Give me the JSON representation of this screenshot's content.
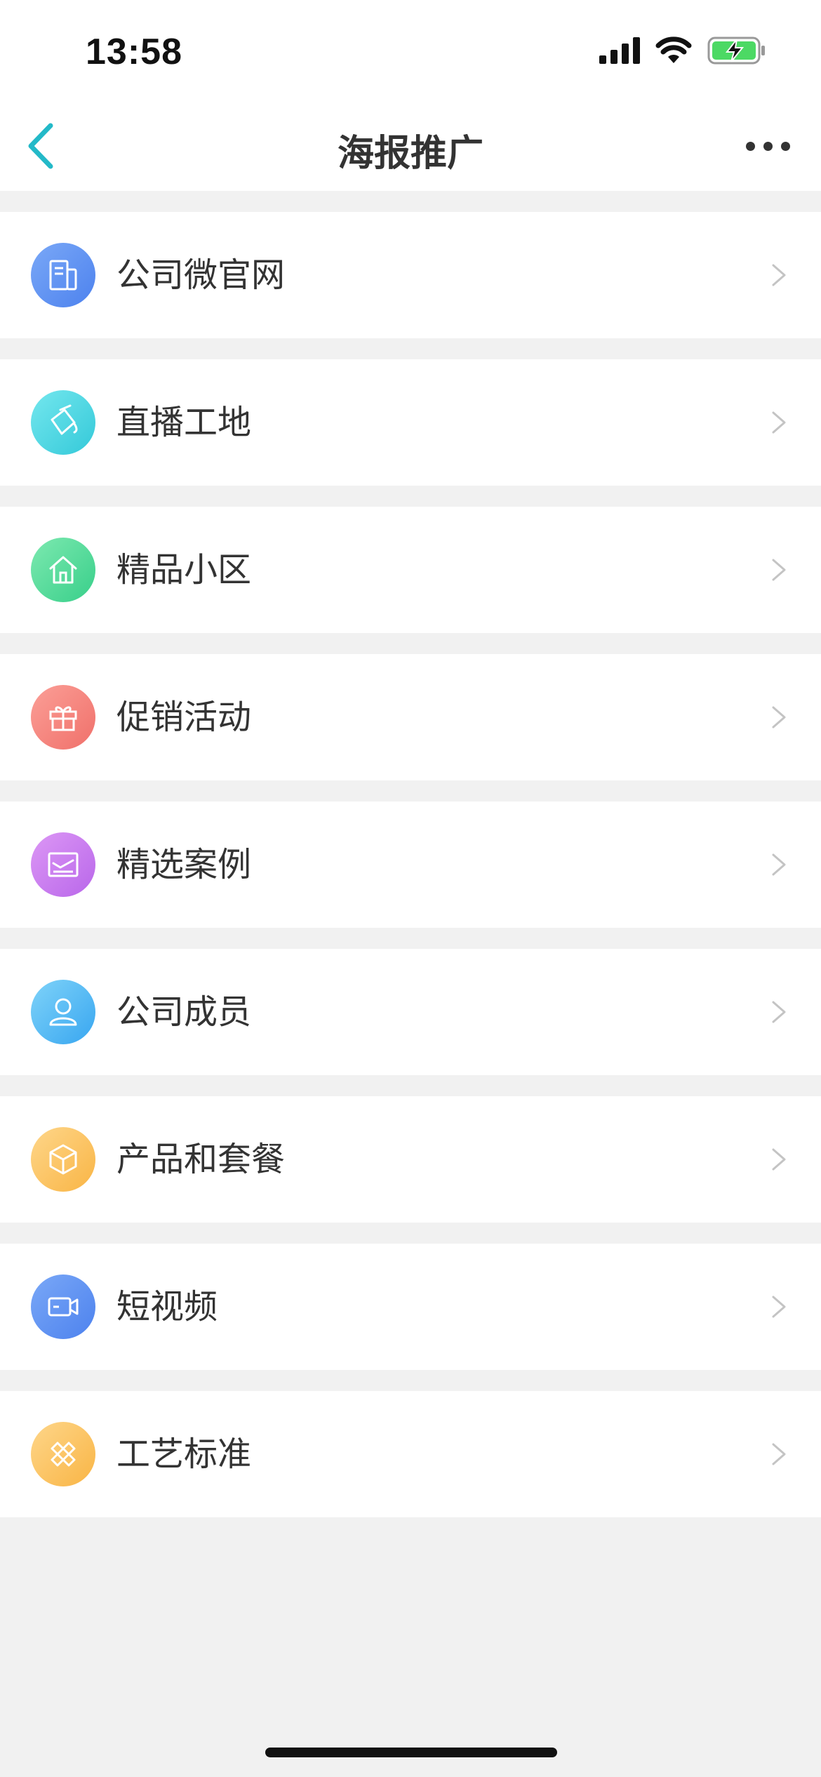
{
  "status_bar": {
    "time": "13:58"
  },
  "nav": {
    "title": "海报推广",
    "back_icon": "chevron-left-icon",
    "more_icon": "more-horizontal-icon"
  },
  "menu": {
    "items": [
      {
        "label": "公司微官网",
        "icon": "document-icon",
        "color_from": "#7aa8f7",
        "color_to": "#4d82ee"
      },
      {
        "label": "直播工地",
        "icon": "paint-bucket-icon",
        "color_from": "#74e7ee",
        "color_to": "#34c9d9"
      },
      {
        "label": "精品小区",
        "icon": "house-icon",
        "color_from": "#7de9b0",
        "color_to": "#38cf8a"
      },
      {
        "label": "促销活动",
        "icon": "gift-icon",
        "color_from": "#fb9f97",
        "color_to": "#f0706a"
      },
      {
        "label": "精选案例",
        "icon": "picture-icon",
        "color_from": "#dc97f5",
        "color_to": "#b967ea"
      },
      {
        "label": "公司成员",
        "icon": "person-icon",
        "color_from": "#7fd3f9",
        "color_to": "#38a6f0"
      },
      {
        "label": "产品和套餐",
        "icon": "box-icon",
        "color_from": "#fed68a",
        "color_to": "#f9b545"
      },
      {
        "label": "短视频",
        "icon": "video-camera-icon",
        "color_from": "#7aa8f7",
        "color_to": "#4d82ee"
      },
      {
        "label": "工艺标准",
        "icon": "ruler-pencil-icon",
        "color_from": "#fed68a",
        "color_to": "#f9b545"
      }
    ]
  }
}
